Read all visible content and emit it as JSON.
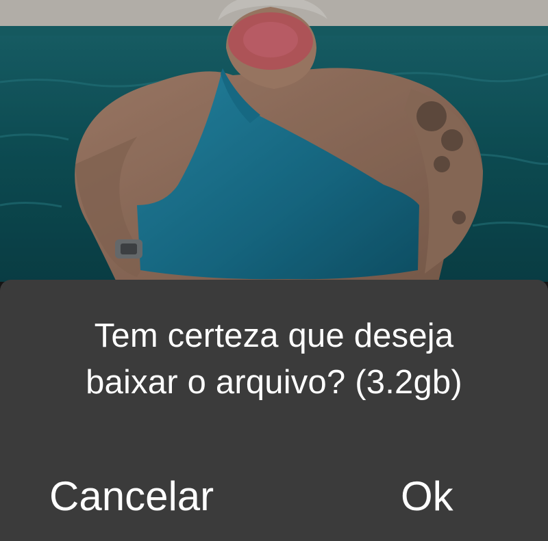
{
  "dialog": {
    "message_line1": "Tem certeza que deseja",
    "message_line2": "baixar o arquivo? (3.2gb)",
    "cancel_label": "Cancelar",
    "ok_label": "Ok"
  },
  "colors": {
    "dialog_background": "#3b3b3b",
    "dialog_text": "#ffffff",
    "pool_water": "#0f5f66",
    "swimsuit": "#1f86a6"
  }
}
